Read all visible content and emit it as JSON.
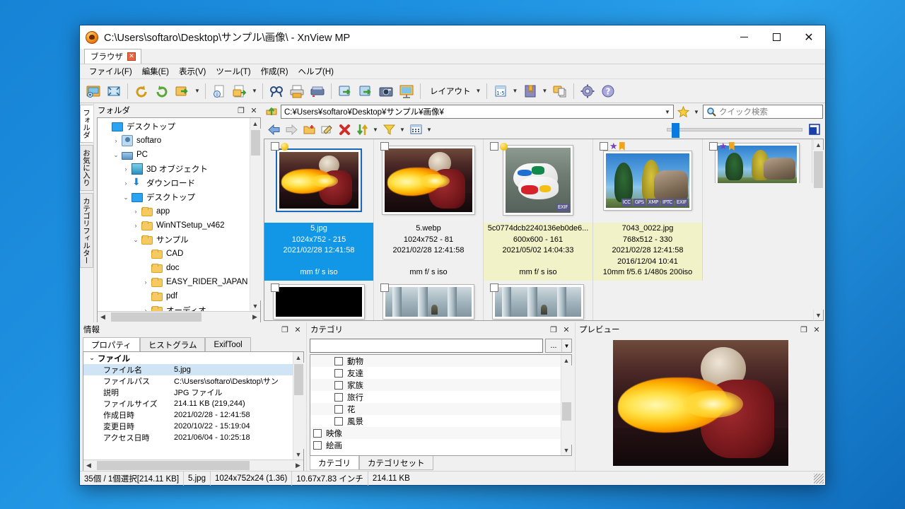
{
  "window": {
    "title": "C:\\Users\\softaro\\Desktop\\サンプル\\画像\\ - XnView MP",
    "icon": "xnview-icon",
    "minimize_label": "",
    "maximize_label": "",
    "close_label": "✕"
  },
  "tabs": [
    {
      "label": "ブラウザ",
      "close": "✕"
    }
  ],
  "menu": [
    "ファイル(F)",
    "編集(E)",
    "表示(V)",
    "ツール(T)",
    "作成(R)",
    "ヘルプ(H)"
  ],
  "toolbar": {
    "layout_label": "レイアウト",
    "buttons": [
      "open-image-icon",
      "fullscreen-icon",
      "rotate-left-icon",
      "rotate-right-icon",
      "convert-icon",
      "info-icon",
      "export-icon",
      "search-icon",
      "print-icon",
      "scanner-icon",
      "batch-convert-icon",
      "batch-rename-icon",
      "screenshot-icon",
      "slideshow-icon",
      "filmstrip-icon",
      "bookmark-icon",
      "copy-to-icon",
      "settings-icon",
      "help-icon"
    ]
  },
  "sidetabs": [
    {
      "label": "フォルダ",
      "active": true
    },
    {
      "label": "お気に入り",
      "active": false
    },
    {
      "label": "カテゴリフィルター",
      "active": false
    }
  ],
  "folder_panel": {
    "title": "フォルダ",
    "float_label": "❐",
    "close_label": "✕",
    "tree": [
      {
        "label": "デスクトップ",
        "indent": 0,
        "twisty": "",
        "icon": "desktop-icon"
      },
      {
        "label": "softaro",
        "indent": 1,
        "twisty": "›",
        "icon": "user-icon"
      },
      {
        "label": "PC",
        "indent": 1,
        "twisty": "⌄",
        "icon": "pc-icon"
      },
      {
        "label": "3D オブジェクト",
        "indent": 2,
        "twisty": "›",
        "icon": "3d-object-icon"
      },
      {
        "label": "ダウンロード",
        "indent": 2,
        "twisty": "›",
        "icon": "download-icon"
      },
      {
        "label": "デスクトップ",
        "indent": 2,
        "twisty": "⌄",
        "icon": "desktop-icon"
      },
      {
        "label": "app",
        "indent": 3,
        "twisty": "›",
        "icon": "folder-icon"
      },
      {
        "label": "WinNTSetup_v462",
        "indent": 3,
        "twisty": "›",
        "icon": "folder-icon"
      },
      {
        "label": "サンプル",
        "indent": 3,
        "twisty": "⌄",
        "icon": "folder-icon"
      },
      {
        "label": "CAD",
        "indent": 4,
        "twisty": "",
        "icon": "folder-icon"
      },
      {
        "label": "doc",
        "indent": 4,
        "twisty": "",
        "icon": "folder-icon"
      },
      {
        "label": "EASY_RIDER_JAPAN",
        "indent": 4,
        "twisty": "›",
        "icon": "folder-icon"
      },
      {
        "label": "pdf",
        "indent": 4,
        "twisty": "",
        "icon": "folder-icon"
      },
      {
        "label": "オーディオ",
        "indent": 4,
        "twisty": "›",
        "icon": "folder-icon"
      }
    ]
  },
  "address": {
    "up_icon": "up-folder-icon",
    "value": "C:¥Users¥softaro¥Desktop¥サンプル¥画像¥",
    "dropdown_icon": "chevron-down-icon",
    "favorites_icon": "star-icon"
  },
  "search": {
    "placeholder": "クイック検索",
    "icon": "magnifier-icon"
  },
  "navbar": {
    "buttons": [
      "back-icon",
      "forward-icon",
      "new-folder-icon",
      "rename-icon",
      "delete-icon",
      "sort-icon",
      "filter-icon",
      "view-mode-icon"
    ],
    "fit_icon": "fit-window-icon"
  },
  "thumbnails": [
    {
      "name": "5.jpg",
      "dims": "1024x752 - 215",
      "date": "2021/02/28 12:41:58",
      "date2": "",
      "exif": "mm f/ s iso",
      "selected": true,
      "art": "ph-fire",
      "w": 118,
      "h": 86,
      "badges": [
        "checkbox",
        "yellow-dot"
      ],
      "tags": []
    },
    {
      "name": "5.webp",
      "dims": "1024x752 - 81",
      "date": "2021/02/28 12:41:58",
      "date2": "",
      "exif": "mm f/ s iso",
      "selected": false,
      "art": "ph-fire",
      "w": 130,
      "h": 96,
      "badges": [
        "checkbox"
      ],
      "tags": []
    },
    {
      "name": "5c0774dcb2240136eb0de6...",
      "dims": "600x600 - 161",
      "date": "2021/05/02 14:04:33",
      "date2": "",
      "exif": "mm f/ s iso",
      "selected": false,
      "kept": true,
      "art": "ph-shoe",
      "w": 98,
      "h": 98,
      "badges": [
        "checkbox",
        "yellow-dot"
      ],
      "tags": [
        "EXIF"
      ]
    },
    {
      "name": "7043_0022.jpg",
      "dims": "768x512 - 330",
      "date": "2021/02/28 12:41:58",
      "date2": "2016/12/04 10:41",
      "exif": "10mm f/5.6 1/480s 200iso",
      "selected": false,
      "kept": true,
      "art": "ph-rock",
      "w": 124,
      "h": 83,
      "badges": [
        "checkbox",
        "star",
        "bookmark"
      ],
      "tags": [
        "ICC",
        "GPS",
        "XMP",
        "IPTC",
        "EXIF"
      ]
    }
  ],
  "thumbnails_row2": [
    {
      "art": "ph-rock",
      "w": 118,
      "h": 60,
      "badges": [
        "checkbox",
        "star",
        "bookmark"
      ]
    },
    {
      "art": "ph-black",
      "w": 128,
      "h": 48,
      "badges": [
        "checkbox"
      ]
    },
    {
      "art": "ph-col",
      "w": 128,
      "h": 48,
      "badges": [
        "checkbox"
      ]
    },
    {
      "art": "ph-col",
      "w": 128,
      "h": 48,
      "badges": [
        "checkbox"
      ]
    }
  ],
  "info_panel": {
    "title": "情報",
    "float_label": "❐",
    "close_label": "✕",
    "tabs": [
      {
        "label": "プロパティ",
        "active": true
      },
      {
        "label": "ヒストグラム",
        "active": false
      },
      {
        "label": "ExifTool",
        "active": false
      }
    ],
    "group_label": "ファイル",
    "group_twisty": "⌄",
    "rows": [
      {
        "key": "ファイル名",
        "value": "5.jpg",
        "selected": true
      },
      {
        "key": "ファイルパス",
        "value": "C:\\Users\\softaro\\Desktop\\サン",
        "selected": false
      },
      {
        "key": "説明",
        "value": "JPG ファイル",
        "selected": false
      },
      {
        "key": "ファイルサイズ",
        "value": "214.11 KB (219,244)",
        "selected": false
      },
      {
        "key": "作成日時",
        "value": "2021/02/28 - 12:41:58",
        "selected": false
      },
      {
        "key": "変更日時",
        "value": "2020/10/22 - 15:19:04",
        "selected": false
      },
      {
        "key": "アクセス日時",
        "value": "2021/06/04 - 10:25:18",
        "selected": false
      }
    ]
  },
  "category_panel": {
    "title": "カテゴリ",
    "float_label": "❐",
    "close_label": "✕",
    "input_value": "",
    "dropdown_label": "...",
    "dropdown_caret": "▼",
    "items": [
      {
        "label": "動物",
        "indent": true
      },
      {
        "label": "友達",
        "indent": true
      },
      {
        "label": "家族",
        "indent": true
      },
      {
        "label": "旅行",
        "indent": true
      },
      {
        "label": "花",
        "indent": true
      },
      {
        "label": "風景",
        "indent": true
      },
      {
        "label": "映像",
        "indent": false
      },
      {
        "label": "絵画",
        "indent": false
      }
    ],
    "tabs": [
      {
        "label": "カテゴリ",
        "active": true
      },
      {
        "label": "カテゴリセット",
        "active": false
      }
    ]
  },
  "preview_panel": {
    "title": "プレビュー",
    "float_label": "❐",
    "close_label": "✕",
    "art": "ph-fire"
  },
  "statusbar": {
    "cells": [
      "35個 / 1個選択[214.11 KB]",
      "5.jpg",
      "1024x752x24 (1.36)",
      "10.67x7.83 インチ",
      "214.11 KB"
    ]
  },
  "colors": {
    "selection_blue": "#1296e6",
    "kept_yellow": "#f2f2c8",
    "window_border": "#0a4a8a",
    "accent": "#0a7ae0"
  }
}
